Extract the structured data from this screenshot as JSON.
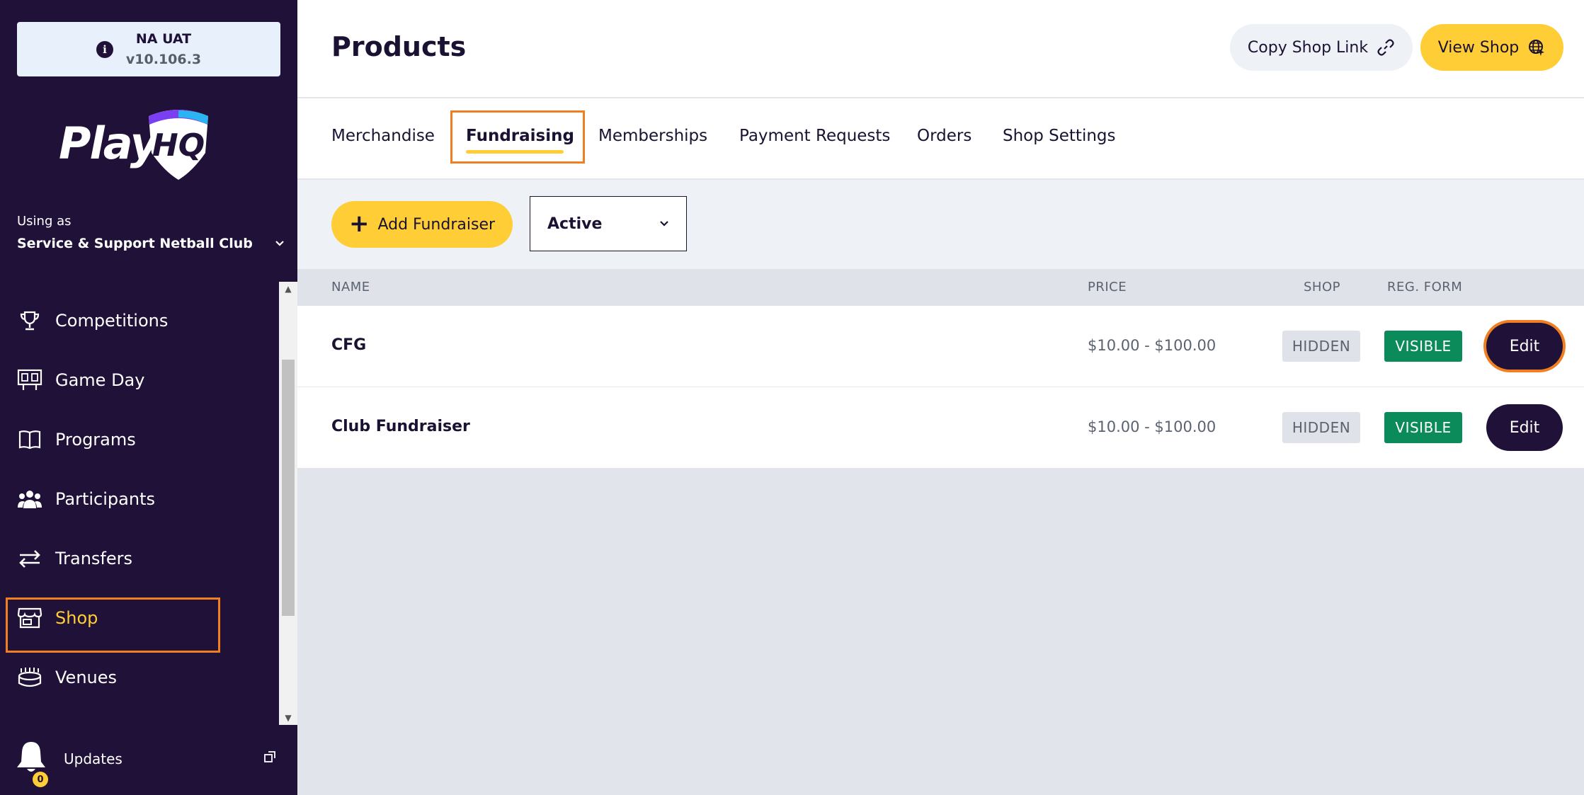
{
  "env": {
    "name": "NA UAT",
    "version": "v10.106.3"
  },
  "logo": {
    "text": "PlayHQ"
  },
  "org": {
    "using_as_label": "Using as",
    "name": "Service & Support Netball Club"
  },
  "nav": [
    {
      "label": "Competitions",
      "icon": "trophy-icon"
    },
    {
      "label": "Game Day",
      "icon": "scoreboard-icon"
    },
    {
      "label": "Programs",
      "icon": "book-icon"
    },
    {
      "label": "Participants",
      "icon": "people-icon"
    },
    {
      "label": "Transfers",
      "icon": "transfer-arrows-icon"
    },
    {
      "label": "Shop",
      "icon": "store-icon",
      "active": true
    },
    {
      "label": "Venues",
      "icon": "stadium-icon"
    }
  ],
  "updates": {
    "label": "Updates",
    "badge": "0"
  },
  "header": {
    "title": "Products",
    "copy_link_label": "Copy Shop Link",
    "view_shop_label": "View Shop"
  },
  "tabs": [
    {
      "label": "Merchandise"
    },
    {
      "label": "Fundraising",
      "active": true
    },
    {
      "label": "Memberships"
    },
    {
      "label": "Payment Requests"
    },
    {
      "label": "Orders"
    },
    {
      "label": "Shop Settings"
    }
  ],
  "toolbar": {
    "add_label": "Add Fundraiser",
    "status_value": "Active"
  },
  "table": {
    "columns": {
      "name": "NAME",
      "price": "PRICE",
      "shop": "SHOP",
      "reg_form": "REG. FORM"
    },
    "rows": [
      {
        "name": "CFG",
        "price": "$10.00 - $100.00",
        "shop": "HIDDEN",
        "reg_form": "VISIBLE",
        "action": "Edit"
      },
      {
        "name": "Club Fundraiser",
        "price": "$10.00 - $100.00",
        "shop": "HIDDEN",
        "reg_form": "VISIBLE",
        "action": "Edit"
      }
    ]
  },
  "colors": {
    "sidebar": "#1f1137",
    "accent": "#ffcd36",
    "highlight": "#f07f22",
    "visible_badge": "#0b8a5a"
  }
}
